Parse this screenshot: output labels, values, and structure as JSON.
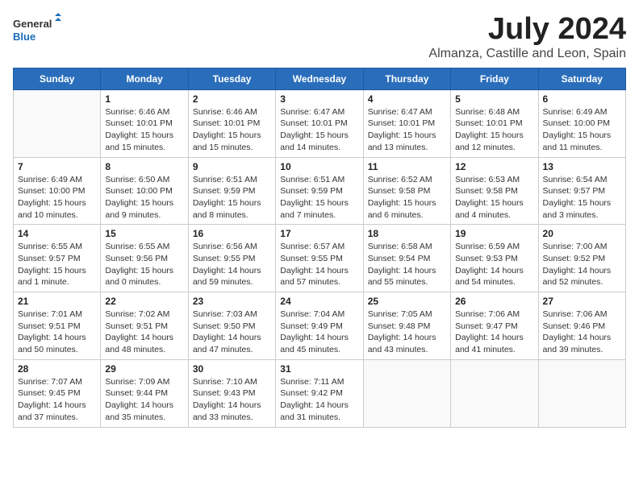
{
  "logo": {
    "general": "General",
    "blue": "Blue"
  },
  "title": "July 2024",
  "subtitle": "Almanza, Castille and Leon, Spain",
  "days_header": [
    "Sunday",
    "Monday",
    "Tuesday",
    "Wednesday",
    "Thursday",
    "Friday",
    "Saturday"
  ],
  "weeks": [
    [
      {
        "day": "",
        "info": ""
      },
      {
        "day": "1",
        "info": "Sunrise: 6:46 AM\nSunset: 10:01 PM\nDaylight: 15 hours\nand 15 minutes."
      },
      {
        "day": "2",
        "info": "Sunrise: 6:46 AM\nSunset: 10:01 PM\nDaylight: 15 hours\nand 15 minutes."
      },
      {
        "day": "3",
        "info": "Sunrise: 6:47 AM\nSunset: 10:01 PM\nDaylight: 15 hours\nand 14 minutes."
      },
      {
        "day": "4",
        "info": "Sunrise: 6:47 AM\nSunset: 10:01 PM\nDaylight: 15 hours\nand 13 minutes."
      },
      {
        "day": "5",
        "info": "Sunrise: 6:48 AM\nSunset: 10:01 PM\nDaylight: 15 hours\nand 12 minutes."
      },
      {
        "day": "6",
        "info": "Sunrise: 6:49 AM\nSunset: 10:00 PM\nDaylight: 15 hours\nand 11 minutes."
      }
    ],
    [
      {
        "day": "7",
        "info": "Sunrise: 6:49 AM\nSunset: 10:00 PM\nDaylight: 15 hours\nand 10 minutes."
      },
      {
        "day": "8",
        "info": "Sunrise: 6:50 AM\nSunset: 10:00 PM\nDaylight: 15 hours\nand 9 minutes."
      },
      {
        "day": "9",
        "info": "Sunrise: 6:51 AM\nSunset: 9:59 PM\nDaylight: 15 hours\nand 8 minutes."
      },
      {
        "day": "10",
        "info": "Sunrise: 6:51 AM\nSunset: 9:59 PM\nDaylight: 15 hours\nand 7 minutes."
      },
      {
        "day": "11",
        "info": "Sunrise: 6:52 AM\nSunset: 9:58 PM\nDaylight: 15 hours\nand 6 minutes."
      },
      {
        "day": "12",
        "info": "Sunrise: 6:53 AM\nSunset: 9:58 PM\nDaylight: 15 hours\nand 4 minutes."
      },
      {
        "day": "13",
        "info": "Sunrise: 6:54 AM\nSunset: 9:57 PM\nDaylight: 15 hours\nand 3 minutes."
      }
    ],
    [
      {
        "day": "14",
        "info": "Sunrise: 6:55 AM\nSunset: 9:57 PM\nDaylight: 15 hours\nand 1 minute."
      },
      {
        "day": "15",
        "info": "Sunrise: 6:55 AM\nSunset: 9:56 PM\nDaylight: 15 hours\nand 0 minutes."
      },
      {
        "day": "16",
        "info": "Sunrise: 6:56 AM\nSunset: 9:55 PM\nDaylight: 14 hours\nand 59 minutes."
      },
      {
        "day": "17",
        "info": "Sunrise: 6:57 AM\nSunset: 9:55 PM\nDaylight: 14 hours\nand 57 minutes."
      },
      {
        "day": "18",
        "info": "Sunrise: 6:58 AM\nSunset: 9:54 PM\nDaylight: 14 hours\nand 55 minutes."
      },
      {
        "day": "19",
        "info": "Sunrise: 6:59 AM\nSunset: 9:53 PM\nDaylight: 14 hours\nand 54 minutes."
      },
      {
        "day": "20",
        "info": "Sunrise: 7:00 AM\nSunset: 9:52 PM\nDaylight: 14 hours\nand 52 minutes."
      }
    ],
    [
      {
        "day": "21",
        "info": "Sunrise: 7:01 AM\nSunset: 9:51 PM\nDaylight: 14 hours\nand 50 minutes."
      },
      {
        "day": "22",
        "info": "Sunrise: 7:02 AM\nSunset: 9:51 PM\nDaylight: 14 hours\nand 48 minutes."
      },
      {
        "day": "23",
        "info": "Sunrise: 7:03 AM\nSunset: 9:50 PM\nDaylight: 14 hours\nand 47 minutes."
      },
      {
        "day": "24",
        "info": "Sunrise: 7:04 AM\nSunset: 9:49 PM\nDaylight: 14 hours\nand 45 minutes."
      },
      {
        "day": "25",
        "info": "Sunrise: 7:05 AM\nSunset: 9:48 PM\nDaylight: 14 hours\nand 43 minutes."
      },
      {
        "day": "26",
        "info": "Sunrise: 7:06 AM\nSunset: 9:47 PM\nDaylight: 14 hours\nand 41 minutes."
      },
      {
        "day": "27",
        "info": "Sunrise: 7:06 AM\nSunset: 9:46 PM\nDaylight: 14 hours\nand 39 minutes."
      }
    ],
    [
      {
        "day": "28",
        "info": "Sunrise: 7:07 AM\nSunset: 9:45 PM\nDaylight: 14 hours\nand 37 minutes."
      },
      {
        "day": "29",
        "info": "Sunrise: 7:09 AM\nSunset: 9:44 PM\nDaylight: 14 hours\nand 35 minutes."
      },
      {
        "day": "30",
        "info": "Sunrise: 7:10 AM\nSunset: 9:43 PM\nDaylight: 14 hours\nand 33 minutes."
      },
      {
        "day": "31",
        "info": "Sunrise: 7:11 AM\nSunset: 9:42 PM\nDaylight: 14 hours\nand 31 minutes."
      },
      {
        "day": "",
        "info": ""
      },
      {
        "day": "",
        "info": ""
      },
      {
        "day": "",
        "info": ""
      }
    ]
  ]
}
